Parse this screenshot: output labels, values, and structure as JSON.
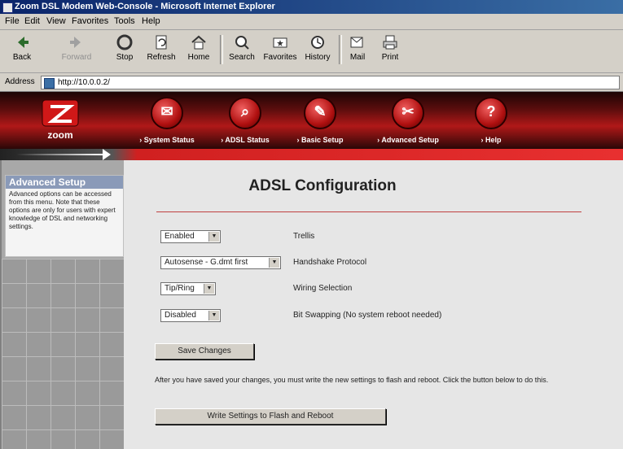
{
  "window": {
    "title": "Zoom DSL Modem Web-Console - Microsoft Internet Explorer"
  },
  "menu": [
    "File",
    "Edit",
    "View",
    "Favorites",
    "Tools",
    "Help"
  ],
  "toolbar": {
    "buttons": [
      {
        "label": "Back",
        "icon": "back-arrow-icon"
      },
      {
        "label": "Forward",
        "icon": "forward-arrow-icon"
      },
      {
        "label": "Stop",
        "icon": "stop-icon"
      },
      {
        "label": "Refresh",
        "icon": "refresh-icon"
      },
      {
        "label": "Home",
        "icon": "home-icon"
      },
      {
        "label": "Search",
        "icon": "search-icon"
      },
      {
        "label": "Favorites",
        "icon": "favorites-icon"
      },
      {
        "label": "History",
        "icon": "history-icon"
      },
      {
        "label": "Mail",
        "icon": "mail-icon"
      },
      {
        "label": "Print",
        "icon": "print-icon"
      }
    ]
  },
  "address": {
    "label": "Address",
    "url": "http://10.0.0.2/"
  },
  "banner": {
    "logo_text": "zoom",
    "nav": [
      {
        "label": "› System Status",
        "icon": "system-status-icon",
        "glyph": "✉"
      },
      {
        "label": "› ADSL Status",
        "icon": "adsl-status-icon",
        "glyph": "⌕"
      },
      {
        "label": "› Basic Setup",
        "icon": "basic-setup-icon",
        "glyph": "✎"
      },
      {
        "label": "› Advanced Setup",
        "icon": "advanced-setup-icon",
        "glyph": "✂"
      },
      {
        "label": "› Help",
        "icon": "help-icon",
        "glyph": "?"
      }
    ]
  },
  "sidebar": {
    "heading": "Advanced Setup",
    "text": "Advanced options can be accessed from this menu. Note that these options are only for users with expert knowledge of DSL and networking settings."
  },
  "main": {
    "title": "ADSL Configuration",
    "fields": [
      {
        "value": "Enabled",
        "label": "Trellis"
      },
      {
        "value": "Autosense - G.dmt first",
        "label": "Handshake Protocol"
      },
      {
        "value": "Tip/Ring",
        "label": "Wiring Selection"
      },
      {
        "value": "Disabled",
        "label": "Bit Swapping (No system reboot needed)"
      }
    ],
    "save_label": "Save Changes",
    "note": "After you have saved your changes, you must write the new settings to flash and reboot. Click the button below to do this.",
    "write_label": "Write Settings to Flash and Reboot"
  }
}
